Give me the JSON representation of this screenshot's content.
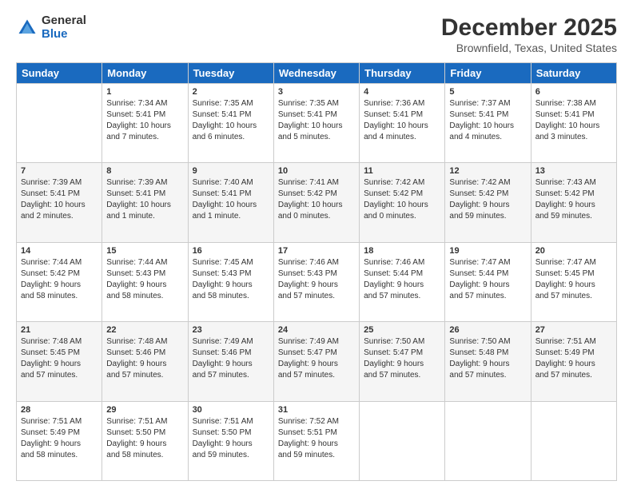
{
  "logo": {
    "general": "General",
    "blue": "Blue"
  },
  "title": "December 2025",
  "location": "Brownfield, Texas, United States",
  "days_of_week": [
    "Sunday",
    "Monday",
    "Tuesday",
    "Wednesday",
    "Thursday",
    "Friday",
    "Saturday"
  ],
  "weeks": [
    [
      {
        "day": "",
        "info": ""
      },
      {
        "day": "1",
        "info": "Sunrise: 7:34 AM\nSunset: 5:41 PM\nDaylight: 10 hours\nand 7 minutes."
      },
      {
        "day": "2",
        "info": "Sunrise: 7:35 AM\nSunset: 5:41 PM\nDaylight: 10 hours\nand 6 minutes."
      },
      {
        "day": "3",
        "info": "Sunrise: 7:35 AM\nSunset: 5:41 PM\nDaylight: 10 hours\nand 5 minutes."
      },
      {
        "day": "4",
        "info": "Sunrise: 7:36 AM\nSunset: 5:41 PM\nDaylight: 10 hours\nand 4 minutes."
      },
      {
        "day": "5",
        "info": "Sunrise: 7:37 AM\nSunset: 5:41 PM\nDaylight: 10 hours\nand 4 minutes."
      },
      {
        "day": "6",
        "info": "Sunrise: 7:38 AM\nSunset: 5:41 PM\nDaylight: 10 hours\nand 3 minutes."
      }
    ],
    [
      {
        "day": "7",
        "info": "Sunrise: 7:39 AM\nSunset: 5:41 PM\nDaylight: 10 hours\nand 2 minutes."
      },
      {
        "day": "8",
        "info": "Sunrise: 7:39 AM\nSunset: 5:41 PM\nDaylight: 10 hours\nand 1 minute."
      },
      {
        "day": "9",
        "info": "Sunrise: 7:40 AM\nSunset: 5:41 PM\nDaylight: 10 hours\nand 1 minute."
      },
      {
        "day": "10",
        "info": "Sunrise: 7:41 AM\nSunset: 5:42 PM\nDaylight: 10 hours\nand 0 minutes."
      },
      {
        "day": "11",
        "info": "Sunrise: 7:42 AM\nSunset: 5:42 PM\nDaylight: 10 hours\nand 0 minutes."
      },
      {
        "day": "12",
        "info": "Sunrise: 7:42 AM\nSunset: 5:42 PM\nDaylight: 9 hours\nand 59 minutes."
      },
      {
        "day": "13",
        "info": "Sunrise: 7:43 AM\nSunset: 5:42 PM\nDaylight: 9 hours\nand 59 minutes."
      }
    ],
    [
      {
        "day": "14",
        "info": "Sunrise: 7:44 AM\nSunset: 5:42 PM\nDaylight: 9 hours\nand 58 minutes."
      },
      {
        "day": "15",
        "info": "Sunrise: 7:44 AM\nSunset: 5:43 PM\nDaylight: 9 hours\nand 58 minutes."
      },
      {
        "day": "16",
        "info": "Sunrise: 7:45 AM\nSunset: 5:43 PM\nDaylight: 9 hours\nand 58 minutes."
      },
      {
        "day": "17",
        "info": "Sunrise: 7:46 AM\nSunset: 5:43 PM\nDaylight: 9 hours\nand 57 minutes."
      },
      {
        "day": "18",
        "info": "Sunrise: 7:46 AM\nSunset: 5:44 PM\nDaylight: 9 hours\nand 57 minutes."
      },
      {
        "day": "19",
        "info": "Sunrise: 7:47 AM\nSunset: 5:44 PM\nDaylight: 9 hours\nand 57 minutes."
      },
      {
        "day": "20",
        "info": "Sunrise: 7:47 AM\nSunset: 5:45 PM\nDaylight: 9 hours\nand 57 minutes."
      }
    ],
    [
      {
        "day": "21",
        "info": "Sunrise: 7:48 AM\nSunset: 5:45 PM\nDaylight: 9 hours\nand 57 minutes."
      },
      {
        "day": "22",
        "info": "Sunrise: 7:48 AM\nSunset: 5:46 PM\nDaylight: 9 hours\nand 57 minutes."
      },
      {
        "day": "23",
        "info": "Sunrise: 7:49 AM\nSunset: 5:46 PM\nDaylight: 9 hours\nand 57 minutes."
      },
      {
        "day": "24",
        "info": "Sunrise: 7:49 AM\nSunset: 5:47 PM\nDaylight: 9 hours\nand 57 minutes."
      },
      {
        "day": "25",
        "info": "Sunrise: 7:50 AM\nSunset: 5:47 PM\nDaylight: 9 hours\nand 57 minutes."
      },
      {
        "day": "26",
        "info": "Sunrise: 7:50 AM\nSunset: 5:48 PM\nDaylight: 9 hours\nand 57 minutes."
      },
      {
        "day": "27",
        "info": "Sunrise: 7:51 AM\nSunset: 5:49 PM\nDaylight: 9 hours\nand 57 minutes."
      }
    ],
    [
      {
        "day": "28",
        "info": "Sunrise: 7:51 AM\nSunset: 5:49 PM\nDaylight: 9 hours\nand 58 minutes."
      },
      {
        "day": "29",
        "info": "Sunrise: 7:51 AM\nSunset: 5:50 PM\nDaylight: 9 hours\nand 58 minutes."
      },
      {
        "day": "30",
        "info": "Sunrise: 7:51 AM\nSunset: 5:50 PM\nDaylight: 9 hours\nand 59 minutes."
      },
      {
        "day": "31",
        "info": "Sunrise: 7:52 AM\nSunset: 5:51 PM\nDaylight: 9 hours\nand 59 minutes."
      },
      {
        "day": "",
        "info": ""
      },
      {
        "day": "",
        "info": ""
      },
      {
        "day": "",
        "info": ""
      }
    ]
  ]
}
